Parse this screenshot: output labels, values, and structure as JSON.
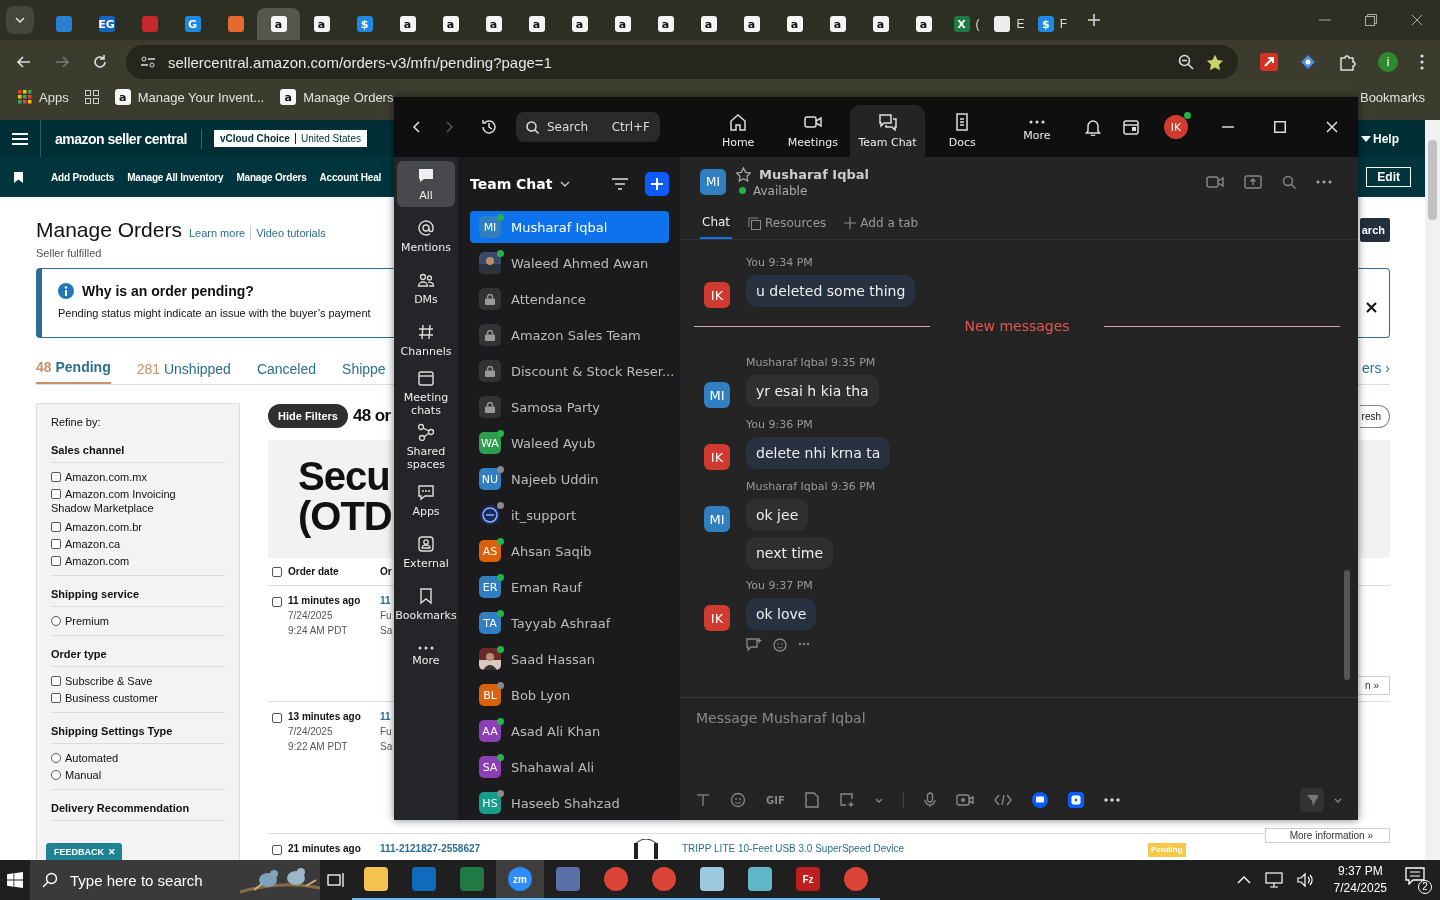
{
  "browser": {
    "tabs": [
      {
        "kind": "hex",
        "selected": false
      },
      {
        "kind": "eg",
        "glyph": "EG",
        "selected": false
      },
      {
        "kind": "dell",
        "selected": false
      },
      {
        "kind": "g",
        "glyph": "G",
        "selected": false
      },
      {
        "kind": "box",
        "selected": false
      },
      {
        "kind": "amazon",
        "glyph": "a",
        "selected": true
      },
      {
        "kind": "amazon",
        "glyph": "a",
        "selected": false
      },
      {
        "kind": "dollar",
        "glyph": "$",
        "selected": false
      },
      {
        "kind": "amazon",
        "glyph": "a",
        "selected": false
      },
      {
        "kind": "amazon",
        "glyph": "a",
        "selected": false
      },
      {
        "kind": "amazon",
        "glyph": "a",
        "selected": false
      },
      {
        "kind": "amazon",
        "glyph": "a",
        "selected": false
      },
      {
        "kind": "amazon",
        "glyph": "a",
        "selected": false
      },
      {
        "kind": "amazon",
        "glyph": "a",
        "selected": false
      },
      {
        "kind": "amazon",
        "glyph": "a",
        "selected": false
      },
      {
        "kind": "amazon",
        "glyph": "a",
        "selected": false
      },
      {
        "kind": "amazon",
        "glyph": "a",
        "selected": false
      },
      {
        "kind": "amazon",
        "glyph": "a",
        "selected": false
      },
      {
        "kind": "amazon",
        "glyph": "a",
        "selected": false
      },
      {
        "kind": "amazon",
        "glyph": "a",
        "selected": false
      },
      {
        "kind": "amazon",
        "glyph": "a",
        "selected": false
      },
      {
        "kind": "excel",
        "glyph": "X",
        "title": "(",
        "selected": false
      },
      {
        "kind": "openai",
        "title": "E",
        "selected": false
      },
      {
        "kind": "dollar",
        "glyph": "$",
        "title": "F",
        "selected": false
      }
    ],
    "url": "sellercentral.amazon.com/orders-v3/mfn/pending?page=1",
    "profile_initial": "i",
    "bookmarks": [
      {
        "kind": "apps",
        "label": "Apps"
      },
      {
        "kind": "grid"
      },
      {
        "kind": "amazon",
        "glyph": "a",
        "label": "Manage Your Invent..."
      },
      {
        "kind": "amazon",
        "glyph": "a",
        "label": "Manage Orders"
      }
    ],
    "all_bookmarks": "Bookmarks"
  },
  "amazon": {
    "logo": "amazon seller central",
    "account": "vCloud Choice",
    "region": "United States",
    "help": "Help",
    "nav": [
      "Add Products",
      "Manage All Inventory",
      "Manage Orders",
      "Account Heal"
    ],
    "edit": "Edit",
    "title": "Manage Orders",
    "links": [
      "Learn more",
      "Video tutorials"
    ],
    "subtitle": "Seller fulfilled",
    "search_button": "arch",
    "notice": {
      "title": "Why is an order pending?",
      "text": "Pending status might indicate an issue with the buyer’s payment"
    },
    "tabs": [
      {
        "count": "48",
        "label": "Pending",
        "selected": true
      },
      {
        "count": "281",
        "label": "Unshipped",
        "selected": false
      },
      {
        "label": "Canceled",
        "selected": false
      },
      {
        "label": "Shippe",
        "selected": false
      }
    ],
    "more_tabs": "ers ›",
    "filters": {
      "heading": "Refine by:",
      "groups": [
        {
          "title": "Sales channel",
          "options": [
            {
              "kind": "checkbox",
              "label": "Amazon.com.mx",
              "checked": false
            },
            {
              "kind": "checkbox",
              "label": "Amazon.com Invoicing",
              "checked": false
            },
            {
              "kind": "note",
              "label": "Shadow Marketplace"
            },
            {
              "kind": "checkbox",
              "label": "Amazon.com.br",
              "checked": false
            },
            {
              "kind": "checkbox",
              "label": "Amazon.ca",
              "checked": false
            },
            {
              "kind": "checkbox",
              "label": "Amazon.com",
              "checked": false
            }
          ]
        },
        {
          "title": "Shipping service",
          "options": [
            {
              "kind": "radio",
              "label": "Premium",
              "checked": false
            }
          ]
        },
        {
          "title": "Order type",
          "options": [
            {
              "kind": "checkbox",
              "label": "Subscribe & Save",
              "checked": false
            },
            {
              "kind": "checkbox",
              "label": "Business customer",
              "checked": false
            }
          ]
        },
        {
          "title": "Shipping Settings Type",
          "options": [
            {
              "kind": "radio",
              "label": "Automated",
              "checked": false
            },
            {
              "kind": "radio",
              "label": "Manual",
              "checked": false
            }
          ]
        },
        {
          "title": "Delivery Recommendation"
        }
      ]
    },
    "hide_filters": "Hide Filters",
    "count_text": "48 or",
    "refresh": "resh",
    "banner": [
      "Secu",
      "(OTD"
    ],
    "columns": [
      "Order date",
      "Or"
    ],
    "select_all_checked": false,
    "orders": [
      {
        "checked": false,
        "age": "11 minutes ago",
        "date": "7/24/2025",
        "time": "9:24 AM PDT",
        "details": [
          "11",
          "Fu",
          "Sa"
        ],
        "more": "n »"
      },
      {
        "checked": false,
        "age": "13 minutes ago",
        "date": "7/24/2025",
        "time": "9:22 AM PDT",
        "details": [
          "11",
          "Fu",
          "Sa"
        ],
        "more": "More information »"
      },
      {
        "checked": false,
        "age": "21 minutes ago",
        "order_id": "111-2121827-2558627",
        "product": "TRIPP LITE 10-Feet USB 3.0 SuperSpeed Device",
        "status": "Pending"
      }
    ],
    "feedback": "FEEDBACK",
    "feedback_close": "✕"
  },
  "zoom": {
    "search": {
      "placeholder": "Search",
      "shortcut": "Ctrl+F"
    },
    "tabs": [
      {
        "kind": "home",
        "label": "Home",
        "selected": false
      },
      {
        "kind": "video",
        "label": "Meetings",
        "selected": false
      },
      {
        "kind": "chat",
        "label": "Team Chat",
        "selected": true
      },
      {
        "kind": "doc",
        "label": "Docs",
        "selected": false
      },
      {
        "kind": "dots",
        "label": "More",
        "selected": false
      }
    ],
    "me": {
      "initials": "IK",
      "color": "#d13b2f",
      "online": true
    },
    "rail": [
      {
        "kind": "chat",
        "label": "All",
        "selected": true
      },
      {
        "kind": "at",
        "label": "Mentions",
        "selected": false
      },
      {
        "kind": "people",
        "label": "DMs",
        "selected": false
      },
      {
        "kind": "hash",
        "label": "Channels",
        "selected": false
      },
      {
        "kind": "calendar",
        "label": "Meeting chats",
        "selected": false
      },
      {
        "kind": "share",
        "label": "Shared spaces",
        "selected": false
      },
      {
        "kind": "apps",
        "label": "Apps",
        "selected": false
      },
      {
        "kind": "external",
        "label": "External",
        "selected": false
      },
      {
        "kind": "bookmark",
        "label": "Bookmarks",
        "selected": false
      },
      {
        "kind": "dots",
        "label": "More",
        "selected": false
      }
    ],
    "list_title": "Team Chat",
    "contacts": [
      {
        "kind": "initials",
        "initials": "MI",
        "color": "#2f7fc1",
        "name": "Musharaf Iqbal",
        "online": true,
        "selected": true
      },
      {
        "name": "Waleed Ahmed Awan",
        "online": true,
        "selected": false
      },
      {
        "kind": "channel",
        "name": "Attendance",
        "selected": false
      },
      {
        "kind": "channel",
        "name": "Amazon Sales Team",
        "selected": false
      },
      {
        "kind": "channel",
        "name": "Discount & Stock Reser...",
        "selected": false
      },
      {
        "kind": "channel",
        "name": "Samosa Party",
        "selected": false
      },
      {
        "kind": "initials",
        "initials": "WA",
        "color": "#2e9e4e",
        "name": "Waleed Ayub",
        "online": true,
        "selected": false
      },
      {
        "kind": "initials",
        "initials": "NU",
        "color": "#2f7fc1",
        "name": "Najeeb Uddin",
        "online": false,
        "selected": false
      },
      {
        "kind": "logo",
        "name": "it_support",
        "online": false,
        "selected": false
      },
      {
        "kind": "initials",
        "initials": "AS",
        "color": "#d9600c",
        "name": "Ahsan Saqib",
        "online": true,
        "selected": false
      },
      {
        "kind": "initials",
        "initials": "ER",
        "color": "#2f7fc1",
        "name": "Eman Rauf",
        "online": true,
        "selected": false
      },
      {
        "kind": "initials",
        "initials": "TA",
        "color": "#2f7fc1",
        "name": "Tayyab Ashraaf",
        "online": true,
        "selected": false
      },
      {
        "name": "Saad Hassan",
        "online": true,
        "selected": false
      },
      {
        "kind": "initials",
        "initials": "BL",
        "color": "#d9600c",
        "name": "Bob Lyon",
        "online": false,
        "selected": false
      },
      {
        "kind": "initials",
        "initials": "AA",
        "color": "#8c3fb5",
        "name": "Asad Ali Khan",
        "online": true,
        "selected": false
      },
      {
        "kind": "initials",
        "initials": "SA",
        "color": "#8c3fb5",
        "name": "Shahawal Ali",
        "online": true,
        "selected": false
      },
      {
        "kind": "initials",
        "initials": "HS",
        "color": "#169c8a",
        "name": "Haseeb Shahzad",
        "online": false,
        "selected": false
      }
    ],
    "chat": {
      "initials": "MI",
      "color": "#2f7fc1",
      "name": "Musharaf Iqbal",
      "status": "Available",
      "online": true,
      "tabs": [
        {
          "kind": "chat",
          "label": "Chat",
          "selected": true
        },
        {
          "kind": "resources",
          "label": "Resources",
          "selected": false
        },
        {
          "kind": "add",
          "label": "Add a tab",
          "selected": false
        }
      ],
      "items": [
        {
          "kind": "group",
          "mine": true,
          "sender": "You",
          "time": "9:34 PM",
          "initials": "IK",
          "color": "#d13b2f",
          "messages": [
            "u deleted some thing"
          ]
        },
        {
          "kind": "divider",
          "label": "New messages"
        },
        {
          "kind": "group",
          "mine": false,
          "sender": "Musharaf Iqbal",
          "time": "9:35 PM",
          "initials": "MI",
          "color": "#2f7fc1",
          "messages": [
            "yr esai h kia tha"
          ]
        },
        {
          "kind": "group",
          "mine": true,
          "sender": "You",
          "time": "9:36 PM",
          "initials": "IK",
          "color": "#d13b2f",
          "messages": [
            "delete nhi krna ta"
          ]
        },
        {
          "kind": "group",
          "mine": false,
          "sender": "Musharaf Iqbal",
          "time": "9:36 PM",
          "initials": "MI",
          "color": "#2f7fc1",
          "messages": [
            "ok jee",
            "next time"
          ]
        },
        {
          "kind": "group",
          "mine": true,
          "sender": "You",
          "time": "9:37 PM",
          "initials": "IK",
          "color": "#d13b2f",
          "messages": [
            "ok love"
          ],
          "actions": true
        }
      ],
      "composer": {
        "placeholder": "Message Musharaf Iqbal",
        "gif": "GIF"
      }
    }
  },
  "taskbar": {
    "search": {
      "placeholder": "Type here to search"
    },
    "apps": [
      {
        "kind": "folder",
        "selected": false
      },
      {
        "kind": "outlook",
        "selected": false
      },
      {
        "kind": "excel",
        "selected": false
      },
      {
        "kind": "zoom",
        "glyph": "zm",
        "selected": true
      },
      {
        "kind": "calculator",
        "selected": false
      },
      {
        "kind": "chrome",
        "selected": false
      },
      {
        "kind": "chrome",
        "selected": false
      },
      {
        "kind": "notes",
        "selected": false
      },
      {
        "kind": "hexagon",
        "selected": false
      },
      {
        "kind": "filezilla",
        "glyph": "Fz",
        "selected": false
      },
      {
        "kind": "chrome",
        "selected": false
      }
    ],
    "time": "9:37 PM",
    "date": "7/24/2025",
    "notifications": "2"
  }
}
